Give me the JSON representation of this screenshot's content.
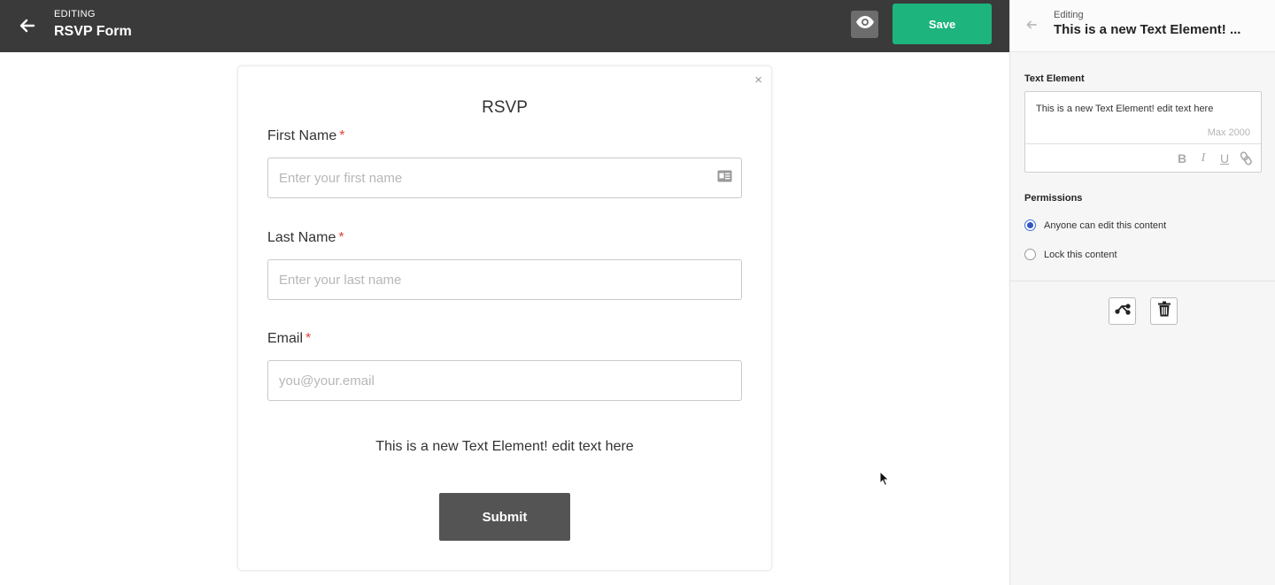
{
  "topbar": {
    "mode_label": "EDITING",
    "form_name": "RSVP Form",
    "save_label": "Save"
  },
  "form": {
    "title": "RSVP",
    "close_glyph": "×",
    "required_mark": "*",
    "fields": [
      {
        "label": "First Name",
        "placeholder": "Enter your first name"
      },
      {
        "label": "Last Name",
        "placeholder": "Enter your last name"
      },
      {
        "label": "Email",
        "placeholder": "you@your.email"
      }
    ],
    "text_element": "This is a new Text Element! edit text here",
    "submit_label": "Submit"
  },
  "panel": {
    "mode_label": "Editing",
    "title": "This is a new Text Element! ...",
    "text_element_label": "Text Element",
    "text_value": "This is a new Text Element! edit text here",
    "max_hint": "Max 2000",
    "tools": [
      "B",
      "I",
      "U"
    ],
    "permissions_label": "Permissions",
    "permissions": [
      {
        "label": "Anyone can edit this content",
        "checked": true
      },
      {
        "label": "Lock this content",
        "checked": false
      }
    ]
  },
  "icons": {
    "back": "arrow-left-icon",
    "preview": "eye-icon",
    "contact_card": "id-card-icon",
    "share": "share-icon",
    "delete": "trash-icon",
    "link": "link-icon"
  },
  "colors": {
    "topbar": "#3a3a3a",
    "save": "#1db47e",
    "submit": "#545454",
    "required": "#e0443b",
    "radio_active": "#2f55c9"
  }
}
